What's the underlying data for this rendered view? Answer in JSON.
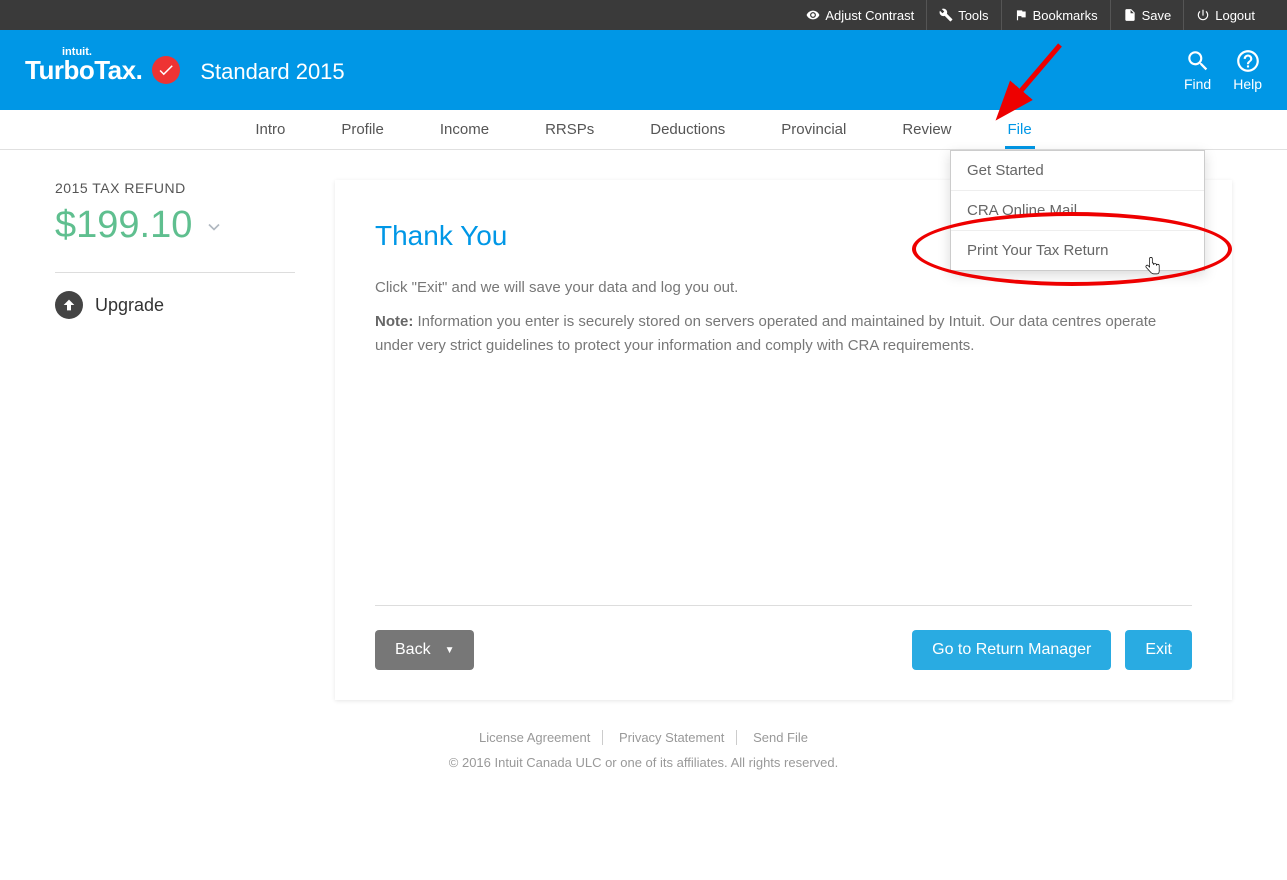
{
  "topbar": {
    "contrast": "Adjust Contrast",
    "tools": "Tools",
    "bookmarks": "Bookmarks",
    "save": "Save",
    "logout": "Logout"
  },
  "header": {
    "brand_parent": "intuit.",
    "brand": "TurboTax.",
    "product": "Standard 2015",
    "find": "Find",
    "help": "Help"
  },
  "nav": {
    "items": [
      "Intro",
      "Profile",
      "Income",
      "RRSPs",
      "Deductions",
      "Provincial",
      "Review",
      "File"
    ],
    "active_index": 7
  },
  "dropdown": {
    "items": [
      "Get Started",
      "CRA Online Mail",
      "Print Your Tax Return"
    ]
  },
  "sidebar": {
    "refund_label": "2015 TAX REFUND",
    "refund_amount": "$199.10",
    "upgrade": "Upgrade"
  },
  "main": {
    "title": "Thank You",
    "line1": "Click \"Exit\" and we will save your data and log you out.",
    "note_label": "Note:",
    "note_text": " Information you enter is securely stored on servers operated and maintained by Intuit. Our data centres operate under very strict guidelines to protect your information and comply with CRA requirements.",
    "back": "Back",
    "return_manager": "Go to Return Manager",
    "exit": "Exit"
  },
  "footer": {
    "license": "License Agreement",
    "privacy": "Privacy Statement",
    "sendfile": "Send File",
    "copyright": "© 2016 Intuit Canada ULC or one of its affiliates. All rights reserved."
  }
}
